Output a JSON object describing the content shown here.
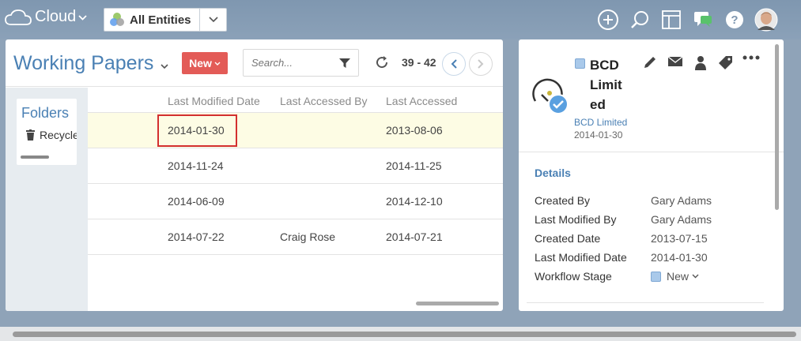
{
  "app": {
    "name": "Cloud"
  },
  "entity_selector": {
    "label": "All Entities"
  },
  "top_icons": [
    "add-icon",
    "search-icon",
    "layout-icon",
    "chat-icon",
    "help-icon",
    "avatar"
  ],
  "main": {
    "title": "Working Papers",
    "new_button": "New",
    "search_placeholder": "Search...",
    "pager": "39 - 42",
    "folders_title": "Folders",
    "recycle_label": "Recycle",
    "columns": [
      "Last Modified Date",
      "Last Accessed By",
      "Last Accessed"
    ],
    "rows": [
      {
        "modified": "2014-01-30",
        "accessed_by": "",
        "accessed": "2013-08-06",
        "selected": true
      },
      {
        "modified": "2014-11-24",
        "accessed_by": "",
        "accessed": "2014-11-25",
        "selected": false
      },
      {
        "modified": "2014-06-09",
        "accessed_by": "",
        "accessed": "2014-12-10",
        "selected": false
      },
      {
        "modified": "2014-07-22",
        "accessed_by": "Craig Rose",
        "accessed": "2014-07-21",
        "selected": false
      }
    ]
  },
  "detail": {
    "name": "BCD Limited",
    "link": "BCD Limited",
    "date": "2014-01-30",
    "section_title": "Details",
    "properties": [
      {
        "label": "Created By",
        "value": "Gary Adams"
      },
      {
        "label": "Last Modified By",
        "value": "Gary Adams"
      },
      {
        "label": "Created Date",
        "value": "2013-07-15"
      },
      {
        "label": "Last Modified Date",
        "value": "2014-01-30"
      },
      {
        "label": "Workflow Stage",
        "value": "New"
      }
    ]
  },
  "colors": {
    "accent": "#4a80b4",
    "new_button": "#e35b57",
    "highlight_row": "#fdfce4",
    "highlight_box": "#d32f2f"
  }
}
